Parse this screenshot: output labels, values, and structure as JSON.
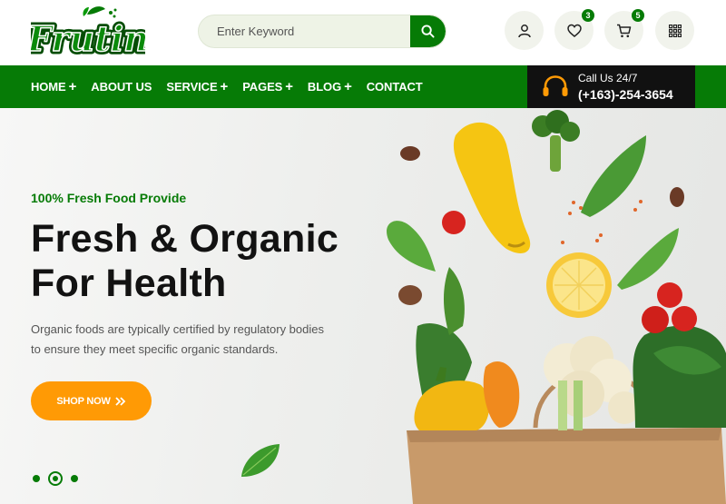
{
  "brand": {
    "name": "Frutin",
    "accent": "#067b06",
    "highlight": "#ff9a05"
  },
  "search": {
    "placeholder": "Enter Keyword",
    "icon": "search-icon"
  },
  "header_actions": [
    {
      "name": "account",
      "icon": "user-icon"
    },
    {
      "name": "wishlist",
      "icon": "heart-icon",
      "count": "3"
    },
    {
      "name": "cart",
      "icon": "cart-icon",
      "count": "5"
    },
    {
      "name": "menu",
      "icon": "grid-icon"
    }
  ],
  "nav": {
    "items": [
      {
        "label": "HOME",
        "has_submenu": true
      },
      {
        "label": "ABOUT US",
        "has_submenu": false
      },
      {
        "label": "SERVICE",
        "has_submenu": true
      },
      {
        "label": "PAGES",
        "has_submenu": true
      },
      {
        "label": "BLOG",
        "has_submenu": true
      },
      {
        "label": "CONTACT",
        "has_submenu": false
      }
    ],
    "submenu_symbol": "+"
  },
  "call": {
    "label": "Call Us 24/7",
    "phone": "(+163)-254-3654",
    "icon": "headset-icon"
  },
  "hero": {
    "subtitle": "100% Fresh Food Provide",
    "title_line1": "Fresh & Organic",
    "title_line2": "For Health",
    "description_line1": "Organic foods are typically certified by regulatory bodies",
    "description_line2": "to ensure they meet specific organic standards.",
    "cta_label": "SHOP NOW",
    "cta_icon": "double-chevron-right-icon",
    "slides_total": 3,
    "active_slide": 2
  }
}
